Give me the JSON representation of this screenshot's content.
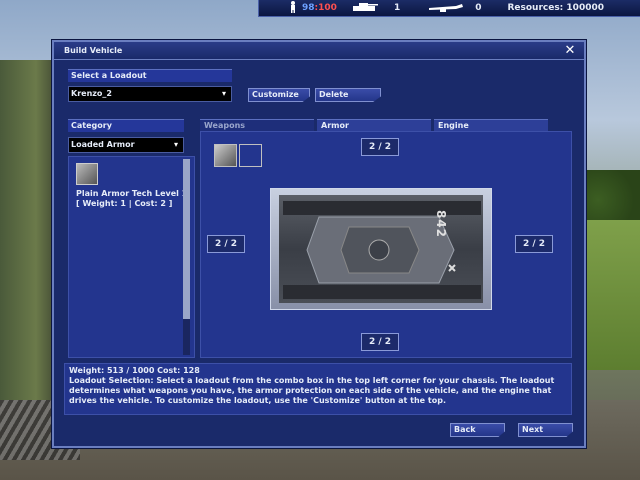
{
  "hud": {
    "health_current": "98",
    "health_max": "100",
    "tank_count": "1",
    "aircraft_count": "0",
    "resources_label": "Resources: 100000"
  },
  "window": {
    "title": "Build Vehicle",
    "close_symbol": "✕"
  },
  "loadout": {
    "label": "Select a Loadout",
    "selected": "Krenzo_2",
    "customize_label": "Customize",
    "delete_label": "Delete"
  },
  "category": {
    "label": "Category",
    "selected": "Loaded Armor",
    "item_line1": "Plain Armor Tech Level 1",
    "item_line2": "[ Weight: 1 | Cost: 2 ]"
  },
  "tabs": [
    "Weapons",
    "Armor",
    "Engine"
  ],
  "slots": {
    "top": "2 / 2",
    "left": "2 / 2",
    "right": "2 / 2",
    "bottom": "2 / 2"
  },
  "vehicle": {
    "number": "842"
  },
  "info": {
    "stats": "Weight: 513 / 1000    Cost: 128",
    "description": "Loadout Selection: Select a loadout from the combo box in the top left corner for your chassis.  The loadout determines what weapons you have, the armor protection on each side of the vehicle, and the engine that drives the vehicle.  To customize the loadout, use the 'Customize' button at the top."
  },
  "nav": {
    "back_label": "Back",
    "next_label": "Next"
  },
  "colors": {
    "window_bg": "#1a2a6a",
    "accent": "#25379a",
    "hp_current": "#6da0ff",
    "hp_max": "#ff5050"
  },
  "icons": [
    "person-icon",
    "tank-icon",
    "aircraft-icon",
    "close-icon",
    "chevron-down-icon"
  ]
}
